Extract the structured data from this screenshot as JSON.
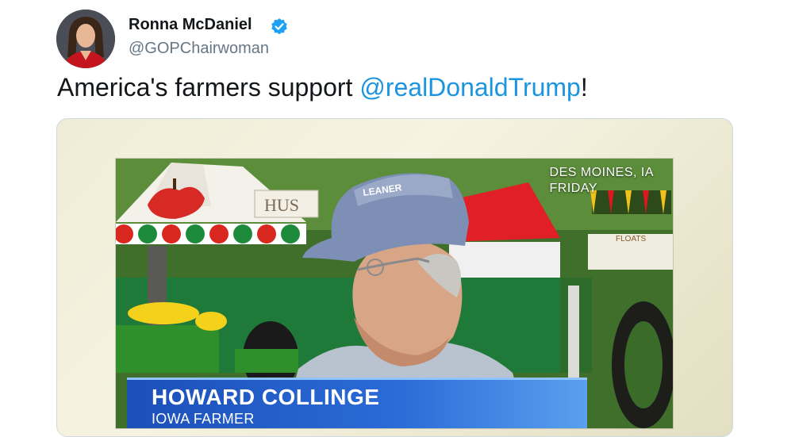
{
  "tweet": {
    "author": {
      "display_name": "Ronna McDaniel",
      "handle": "@GOPChairwoman",
      "verified": true
    },
    "text_prefix": "America's farmers support ",
    "mention": "@realDonaldTrump",
    "text_suffix": "!"
  },
  "video": {
    "location_line1": "DES MOINES, IA",
    "location_line2": "FRIDAY",
    "subject_name": "HOWARD COLLINGE",
    "subject_title": "IOWA FARMER",
    "background_signage": "HUS",
    "floats_sign": "FLOATS",
    "cap_logo_text": "LEANER"
  },
  "colors": {
    "mention": "#1b95e0",
    "verified_badge": "#1da1f2",
    "lower_third": "#1c4fb9"
  }
}
